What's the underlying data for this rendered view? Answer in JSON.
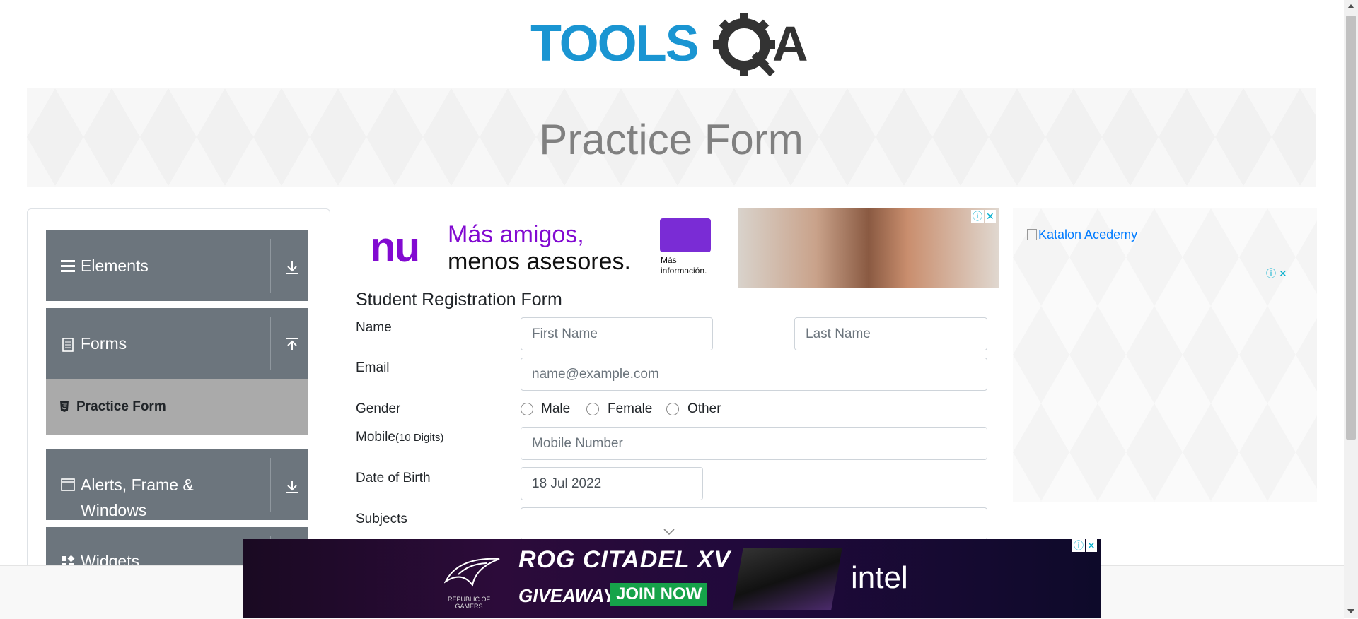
{
  "site": {
    "logo_text": "TOOLSQA",
    "page_title": "Practice Form"
  },
  "sidebar": {
    "groups": [
      {
        "label": "Elements",
        "icon": "hamburger-icon",
        "arrow": "download-arrow-icon"
      },
      {
        "label": "Forms",
        "icon": "document-icon",
        "arrow": "upload-arrow-icon"
      },
      {
        "label": "Alerts, Frame & Windows",
        "icon": "window-icon",
        "arrow": "download-arrow-icon"
      },
      {
        "label": "Widgets",
        "icon": "widgets-icon",
        "arrow": "download-arrow-icon"
      }
    ],
    "active_item": {
      "label": "Practice Form",
      "icon": "html5-icon"
    }
  },
  "ad_top": {
    "brand": "nu",
    "line1": "Más amigos,",
    "line2": "menos asesores.",
    "link": "Más información.",
    "badge_info": "ⓘ",
    "badge_close": "✕"
  },
  "form": {
    "title": "Student Registration Form",
    "name_label": "Name",
    "first_name_placeholder": "First Name",
    "last_name_placeholder": "Last Name",
    "email_label": "Email",
    "email_placeholder": "name@example.com",
    "gender_label": "Gender",
    "genders": [
      "Male",
      "Female",
      "Other"
    ],
    "mobile_label": "Mobile",
    "mobile_hint": "(10 Digits)",
    "mobile_placeholder": "Mobile Number",
    "dob_label": "Date of Birth",
    "dob_value": "18 Jul 2022",
    "subjects_label": "Subjects"
  },
  "ad_right": {
    "alt_text": "Katalon Acedemy",
    "badge_info": "ⓘ",
    "badge_close": "✕"
  },
  "ad_bottom": {
    "title": "ROG CITADEL XV",
    "giveaway": "GIVEAWAY",
    "cta": "JOIN NOW",
    "sponsor": "intel",
    "rog_text": "REPUBLIC OF GAMERS",
    "badge_info": "ⓘ",
    "badge_close": "✕"
  }
}
